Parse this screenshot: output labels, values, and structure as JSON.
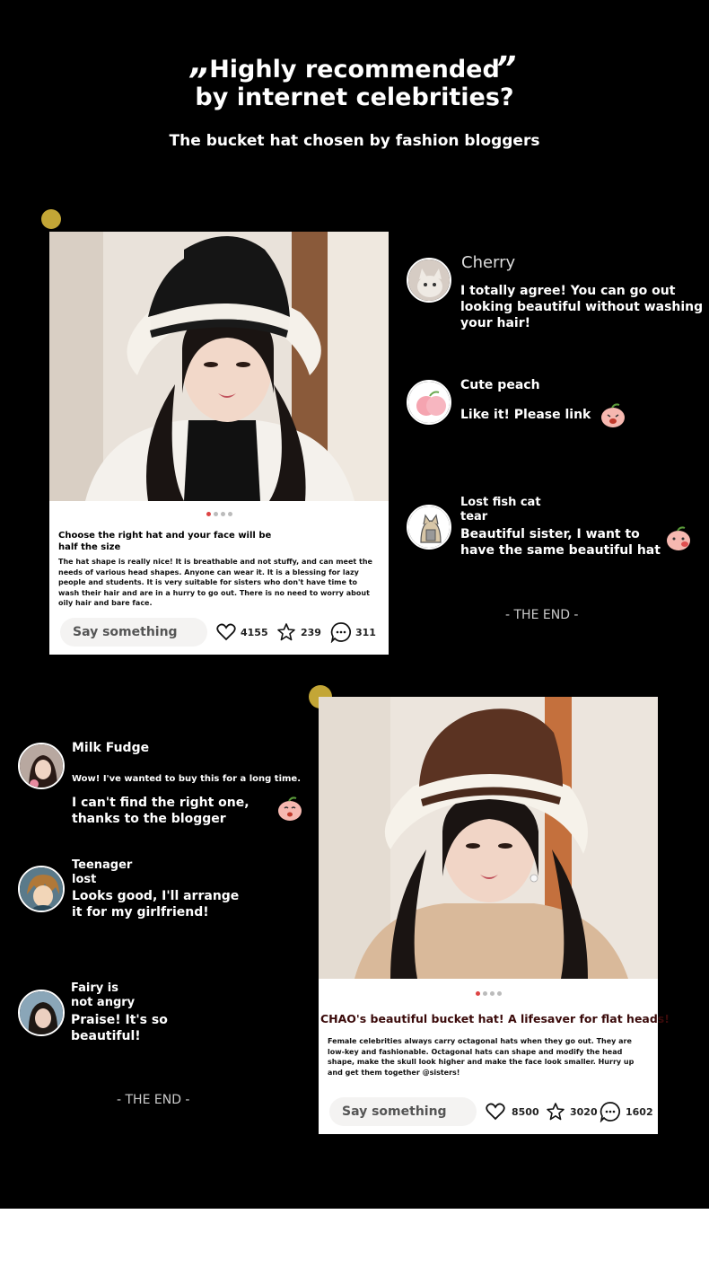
{
  "header": {
    "open_quote": "„",
    "close_quote": "”",
    "line1": "Highly recommended",
    "line2": "by internet celebrities?",
    "subtitle": "The bucket hat chosen by fashion bloggers"
  },
  "post1": {
    "title": "Choose the right hat and your face will be half the size",
    "body": "The hat shape is really nice! It is breathable and not stuffy, and can meet the needs of various head shapes. Anyone can wear it. It is a blessing for lazy people and students. It is very suitable for sisters who don't have time to wash their hair and are in a hurry to go out. There is no need to worry about oily hair and bare face.",
    "comment_placeholder": "Say something",
    "likes": "4155",
    "favorites": "239",
    "comments": "311"
  },
  "comments1": [
    {
      "name": "Cherry",
      "text": "I totally agree! You can go out looking beautiful without washing your hair!"
    },
    {
      "name": "Cute peach",
      "text": "Like it! Please link"
    },
    {
      "name": "Lost fish cat tear",
      "text": "Beautiful sister, I want to have the same beautiful hat"
    }
  ],
  "the_end_1": "- THE END -",
  "post2": {
    "title": "CHAO's beautiful bucket hat! A lifesaver for flat heads!",
    "body": "Female celebrities always carry octagonal hats when they go out. They are low-key and fashionable. Octagonal hats can shape and modify the head shape, make the skull look higher and make the face look smaller. Hurry up and get them together @sisters!",
    "comment_placeholder": "Say something",
    "likes": "8500",
    "favorites": "3020",
    "comments": "1602"
  },
  "comments2": [
    {
      "name": "Milk Fudge",
      "text_small": "Wow! I've wanted to buy this for a long time.",
      "text": "I can't find the right one, thanks to the blogger"
    },
    {
      "name": "Teenager lost",
      "text": "Looks good, I'll arrange it for my girlfriend!"
    },
    {
      "name": "Fairy is not angry",
      "text": "Praise! It's so beautiful!"
    }
  ],
  "the_end_2": "- THE END -",
  "colors": {
    "background": "#000000",
    "accent_dot": "#c3a636",
    "pager_active": "#dd4444"
  }
}
